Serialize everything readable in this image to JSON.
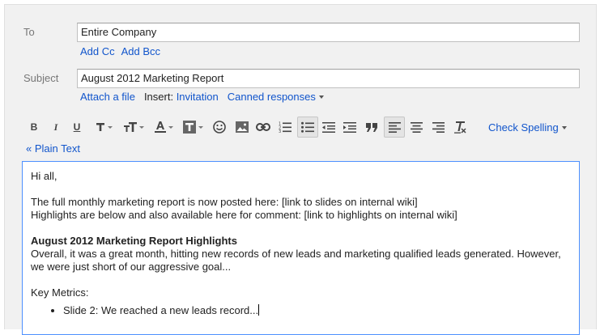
{
  "to": {
    "label": "To",
    "value": "Entire Company",
    "add_cc": "Add Cc",
    "add_bcc": "Add Bcc"
  },
  "subject": {
    "label": "Subject",
    "value": "August 2012 Marketing Report",
    "attach": "Attach a file",
    "insert_label": "Insert:",
    "invitation": "Invitation",
    "canned": "Canned responses"
  },
  "toolbar": {
    "bold": "B",
    "italic": "I",
    "underline": "U",
    "check_spelling": "Check Spelling",
    "plain_text": "« Plain Text"
  },
  "body": {
    "greeting": "Hi all,",
    "line1": "The full monthly marketing report is now posted here: [link to slides on internal wiki]",
    "line2": "Highlights are below and also available here for comment: [link to highlights on internal wiki]",
    "heading": "August 2012 Marketing Report Highlights",
    "para": "Overall, it was a great month, hitting new records of new leads and marketing qualified leads generated. However, we were just short of our aggressive goal...",
    "metrics_label": "Key Metrics:",
    "bullets": [
      "Slide 2: We reached a new leads record..."
    ]
  },
  "colors": {
    "link": "#1155cc",
    "focus_border": "#4d90fe",
    "panel": "#f1f1f1"
  }
}
